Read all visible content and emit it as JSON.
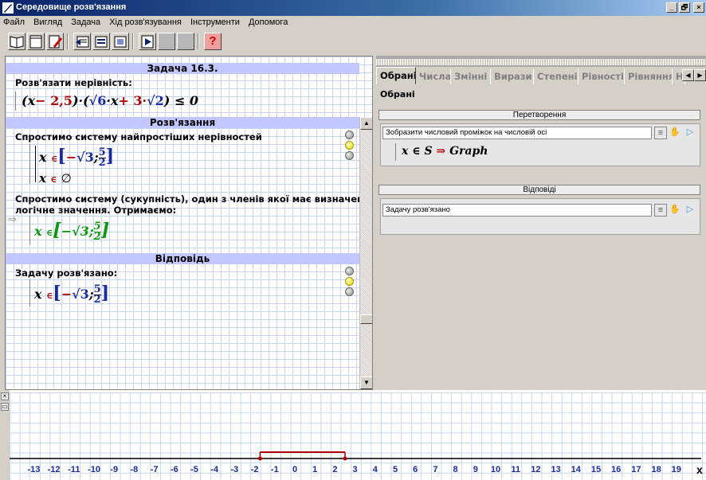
{
  "window": {
    "title": "Середовище розв'язання",
    "buttons": [
      "_",
      "🗗",
      "×"
    ]
  },
  "menu": [
    "Файл",
    "Вигляд",
    "Задача",
    "Хід розв'язування",
    "Інструменти",
    "Допомога"
  ],
  "toolbar": {
    "icons": [
      "book-icon",
      "notebook-icon",
      "edit-icon",
      "step-back-icon",
      "step-list-icon",
      "step-compare-icon",
      "play-icon",
      "disabled-icon",
      "disabled-icon",
      "help-icon"
    ],
    "help_label": "?"
  },
  "task": {
    "header": "Задача 16.3.",
    "prompt": "Розв'язати нерівність:",
    "expression": {
      "open": "(",
      "x": "x",
      "minus_const": "− 2,5",
      "close": ")",
      "dot": "·",
      "open2": "(",
      "sqrt6": "√6",
      "times_x": "·x",
      "plus3": "+ 3·",
      "sqrt2": "√2",
      "close2": ")",
      "rel": "≤ 0"
    }
  },
  "solution": {
    "header": "Розв'язання",
    "step1_text": "Спростимо систему найпростіших нерівностей",
    "step1_line1": {
      "x": "x",
      "in": "∈",
      "lb": "[",
      "neg": "−",
      "sqrt": "√3",
      "sep": ";",
      "frac_num": "5",
      "frac_den": "2",
      "rb": "]"
    },
    "step1_line2": {
      "x": "x",
      "in": "∈",
      "empty": "∅"
    },
    "step2_text_line1": "Спростимо систему (сукупність), один з членів якої має визначене",
    "step2_text_line2": "логічне значення. Отримаємо:",
    "arrow": "⇒",
    "step2_result": {
      "x": "x",
      "in": "∈",
      "lb": "[",
      "neg": "−",
      "sqrt": "√3",
      "sep": ";",
      "frac_num": "5",
      "frac_den": "2",
      "rb": "]"
    }
  },
  "answer": {
    "header": "Відповідь",
    "text": "Задачу розв'язано:",
    "result": {
      "x": "x",
      "in": "∈",
      "lb": "[",
      "neg": "−",
      "sqrt": "√3",
      "sep": ";",
      "frac_num": "5",
      "frac_den": "2",
      "rb": "]"
    }
  },
  "right_panel": {
    "tabs": [
      "Обрані",
      "Числа",
      "Змінні",
      "Вирази",
      "Степені",
      "Рівності",
      "Рівняння",
      "Н"
    ],
    "active_tab": "Обрані",
    "section_label": "Обрані",
    "transform": {
      "title": "Перетворення",
      "combo": "Зобразити числовий проміжок на числовій осі",
      "rule": {
        "lhs": "x ∈ S",
        "arrow": "⇒",
        "rhs": "Graph"
      }
    },
    "answers": {
      "title": "Відповіді",
      "combo": "Задачу розв'язано"
    }
  },
  "number_line": {
    "ticks": [
      "-13",
      "-12",
      "-11",
      "-10",
      "-9",
      "-8",
      "-7",
      "-6",
      "-5",
      "-4",
      "-3",
      "-2",
      "-1",
      "0",
      "1",
      "2",
      "3",
      "4",
      "5",
      "6",
      "7",
      "8",
      "9",
      "10",
      "11",
      "12",
      "13",
      "14",
      "15",
      "16",
      "17",
      "18",
      "19"
    ],
    "interval": [
      -1.732,
      2.5
    ],
    "axis_label": "x",
    "axis_color": "#000000",
    "interval_color": "#b00000",
    "tick_label_color": "#1a2aa0"
  }
}
